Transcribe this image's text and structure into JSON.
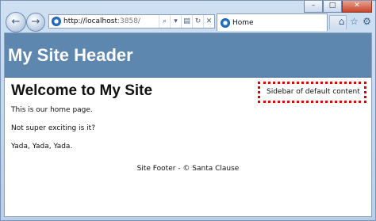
{
  "browser": {
    "address": "http://localhost:3858/",
    "address_host": "http://localhost",
    "address_port": ":3858/",
    "tab_title": "Home"
  },
  "site": {
    "header": "My Site Header",
    "heading": "Welcome to My Site",
    "paragraphs": [
      "This is our home page.",
      "Not super exciting is it?",
      "Yada, Yada, Yada."
    ],
    "sidebar": "Sidebar of default content",
    "footer": "Site Footer - © Santa Clause"
  },
  "colors": {
    "header_bg": "#5e87b0",
    "sidebar_border": "#e00000"
  }
}
